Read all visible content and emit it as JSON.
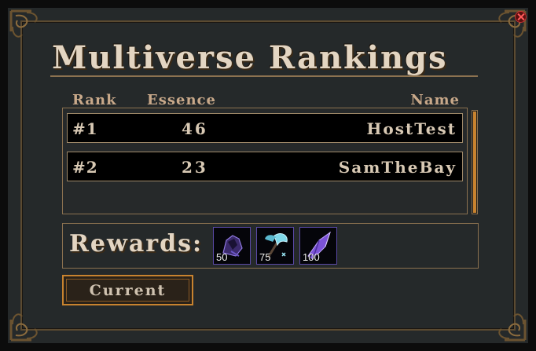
{
  "window": {
    "title": "Multiverse Rankings"
  },
  "columns": {
    "rank": "Rank",
    "essence": "Essence",
    "name": "Name"
  },
  "rankings": [
    {
      "rank": "#1",
      "essence": "46",
      "name": "HostTest"
    },
    {
      "rank": "#2",
      "essence": "23",
      "name": "SamTheBay"
    }
  ],
  "rewards": {
    "label": "Rewards:",
    "items": [
      {
        "icon": "shadow-gauntlet-icon",
        "quantity": "50"
      },
      {
        "icon": "frost-axe-icon",
        "quantity": "75"
      },
      {
        "icon": "amethyst-shard-icon",
        "quantity": "100"
      }
    ]
  },
  "buttons": {
    "current": "Current"
  },
  "colors": {
    "accent": "#c8832f",
    "frame": "#8c7250",
    "text": "#e3d5c2",
    "close": "#ff3333"
  }
}
